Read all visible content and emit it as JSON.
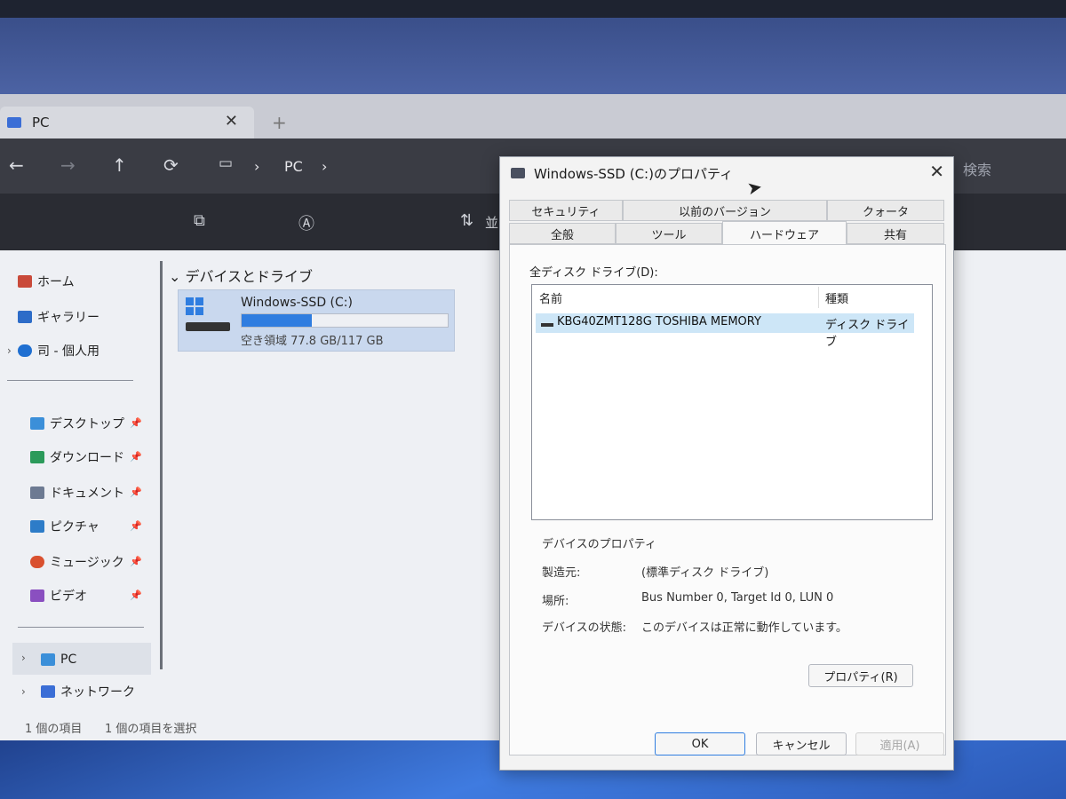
{
  "explorer": {
    "tab_title": "PC",
    "tab_close": "✕",
    "new_tab": "+",
    "nav": {
      "back": "←",
      "forward": "→",
      "up": "↑",
      "refresh": "⟳"
    },
    "breadcrumb": {
      "location": "PC",
      "sep": "›"
    },
    "search_placeholder": "検索",
    "toolbar": {
      "sort_label": "並"
    },
    "sidebar": {
      "top": [
        {
          "label": "ホーム",
          "icon": "home-icon"
        },
        {
          "label": "ギャラリー",
          "icon": "gallery-icon"
        },
        {
          "label": "司 - 個人用",
          "icon": "cloud-icon"
        }
      ],
      "pinned": [
        {
          "label": "デスクトップ",
          "icon": "desktop-icon",
          "color": "#3b8fd9"
        },
        {
          "label": "ダウンロード",
          "icon": "download-icon",
          "color": "#2b9a5a"
        },
        {
          "label": "ドキュメント",
          "icon": "document-icon",
          "color": "#6d7a92"
        },
        {
          "label": "ピクチャ",
          "icon": "pictures-icon",
          "color": "#2d7cc8"
        },
        {
          "label": "ミュージック",
          "icon": "music-icon",
          "color": "#d9502f"
        },
        {
          "label": "ビデオ",
          "icon": "video-icon",
          "color": "#8a4fc0"
        }
      ],
      "bottom": [
        {
          "label": "PC",
          "icon": "pc-icon"
        },
        {
          "label": "ネットワーク",
          "icon": "network-icon"
        }
      ]
    },
    "section_title": "デバイスとドライブ",
    "drive": {
      "name": "Windows-SSD (C:)",
      "free_text": "空き領域 77.8 GB/117 GB",
      "used_fraction": 0.34
    },
    "status": {
      "count": "1 個の項目",
      "selected": "1 個の項目を選択"
    }
  },
  "dialog": {
    "title": "Windows-SSD (C:)のプロパティ",
    "close": "✕",
    "tabs_row1": [
      "セキュリティ",
      "以前のバージョン",
      "クォータ"
    ],
    "tabs_row2": [
      "全般",
      "ツール",
      "ハードウェア",
      "共有"
    ],
    "active_tab": "ハードウェア",
    "list_label": "全ディスク ドライブ(D):",
    "columns": [
      "名前",
      "種類"
    ],
    "rows": [
      {
        "name": "KBG40ZMT128G TOSHIBA MEMORY",
        "type": "ディスク ドライブ"
      }
    ],
    "props": {
      "title": "デバイスのプロパティ",
      "manufacturer_label": "製造元:",
      "manufacturer_value": "(標準ディスク ドライブ)",
      "location_label": "場所:",
      "location_value": "Bus Number 0, Target Id 0, LUN 0",
      "status_label": "デバイスの状態:",
      "status_value": "このデバイスは正常に動作しています。"
    },
    "buttons": {
      "properties": "プロパティ(R)",
      "ok": "OK",
      "cancel": "キャンセル",
      "apply": "適用(A)"
    }
  },
  "colors": {
    "accent": "#2f7de0",
    "selection": "#cde6f7"
  }
}
